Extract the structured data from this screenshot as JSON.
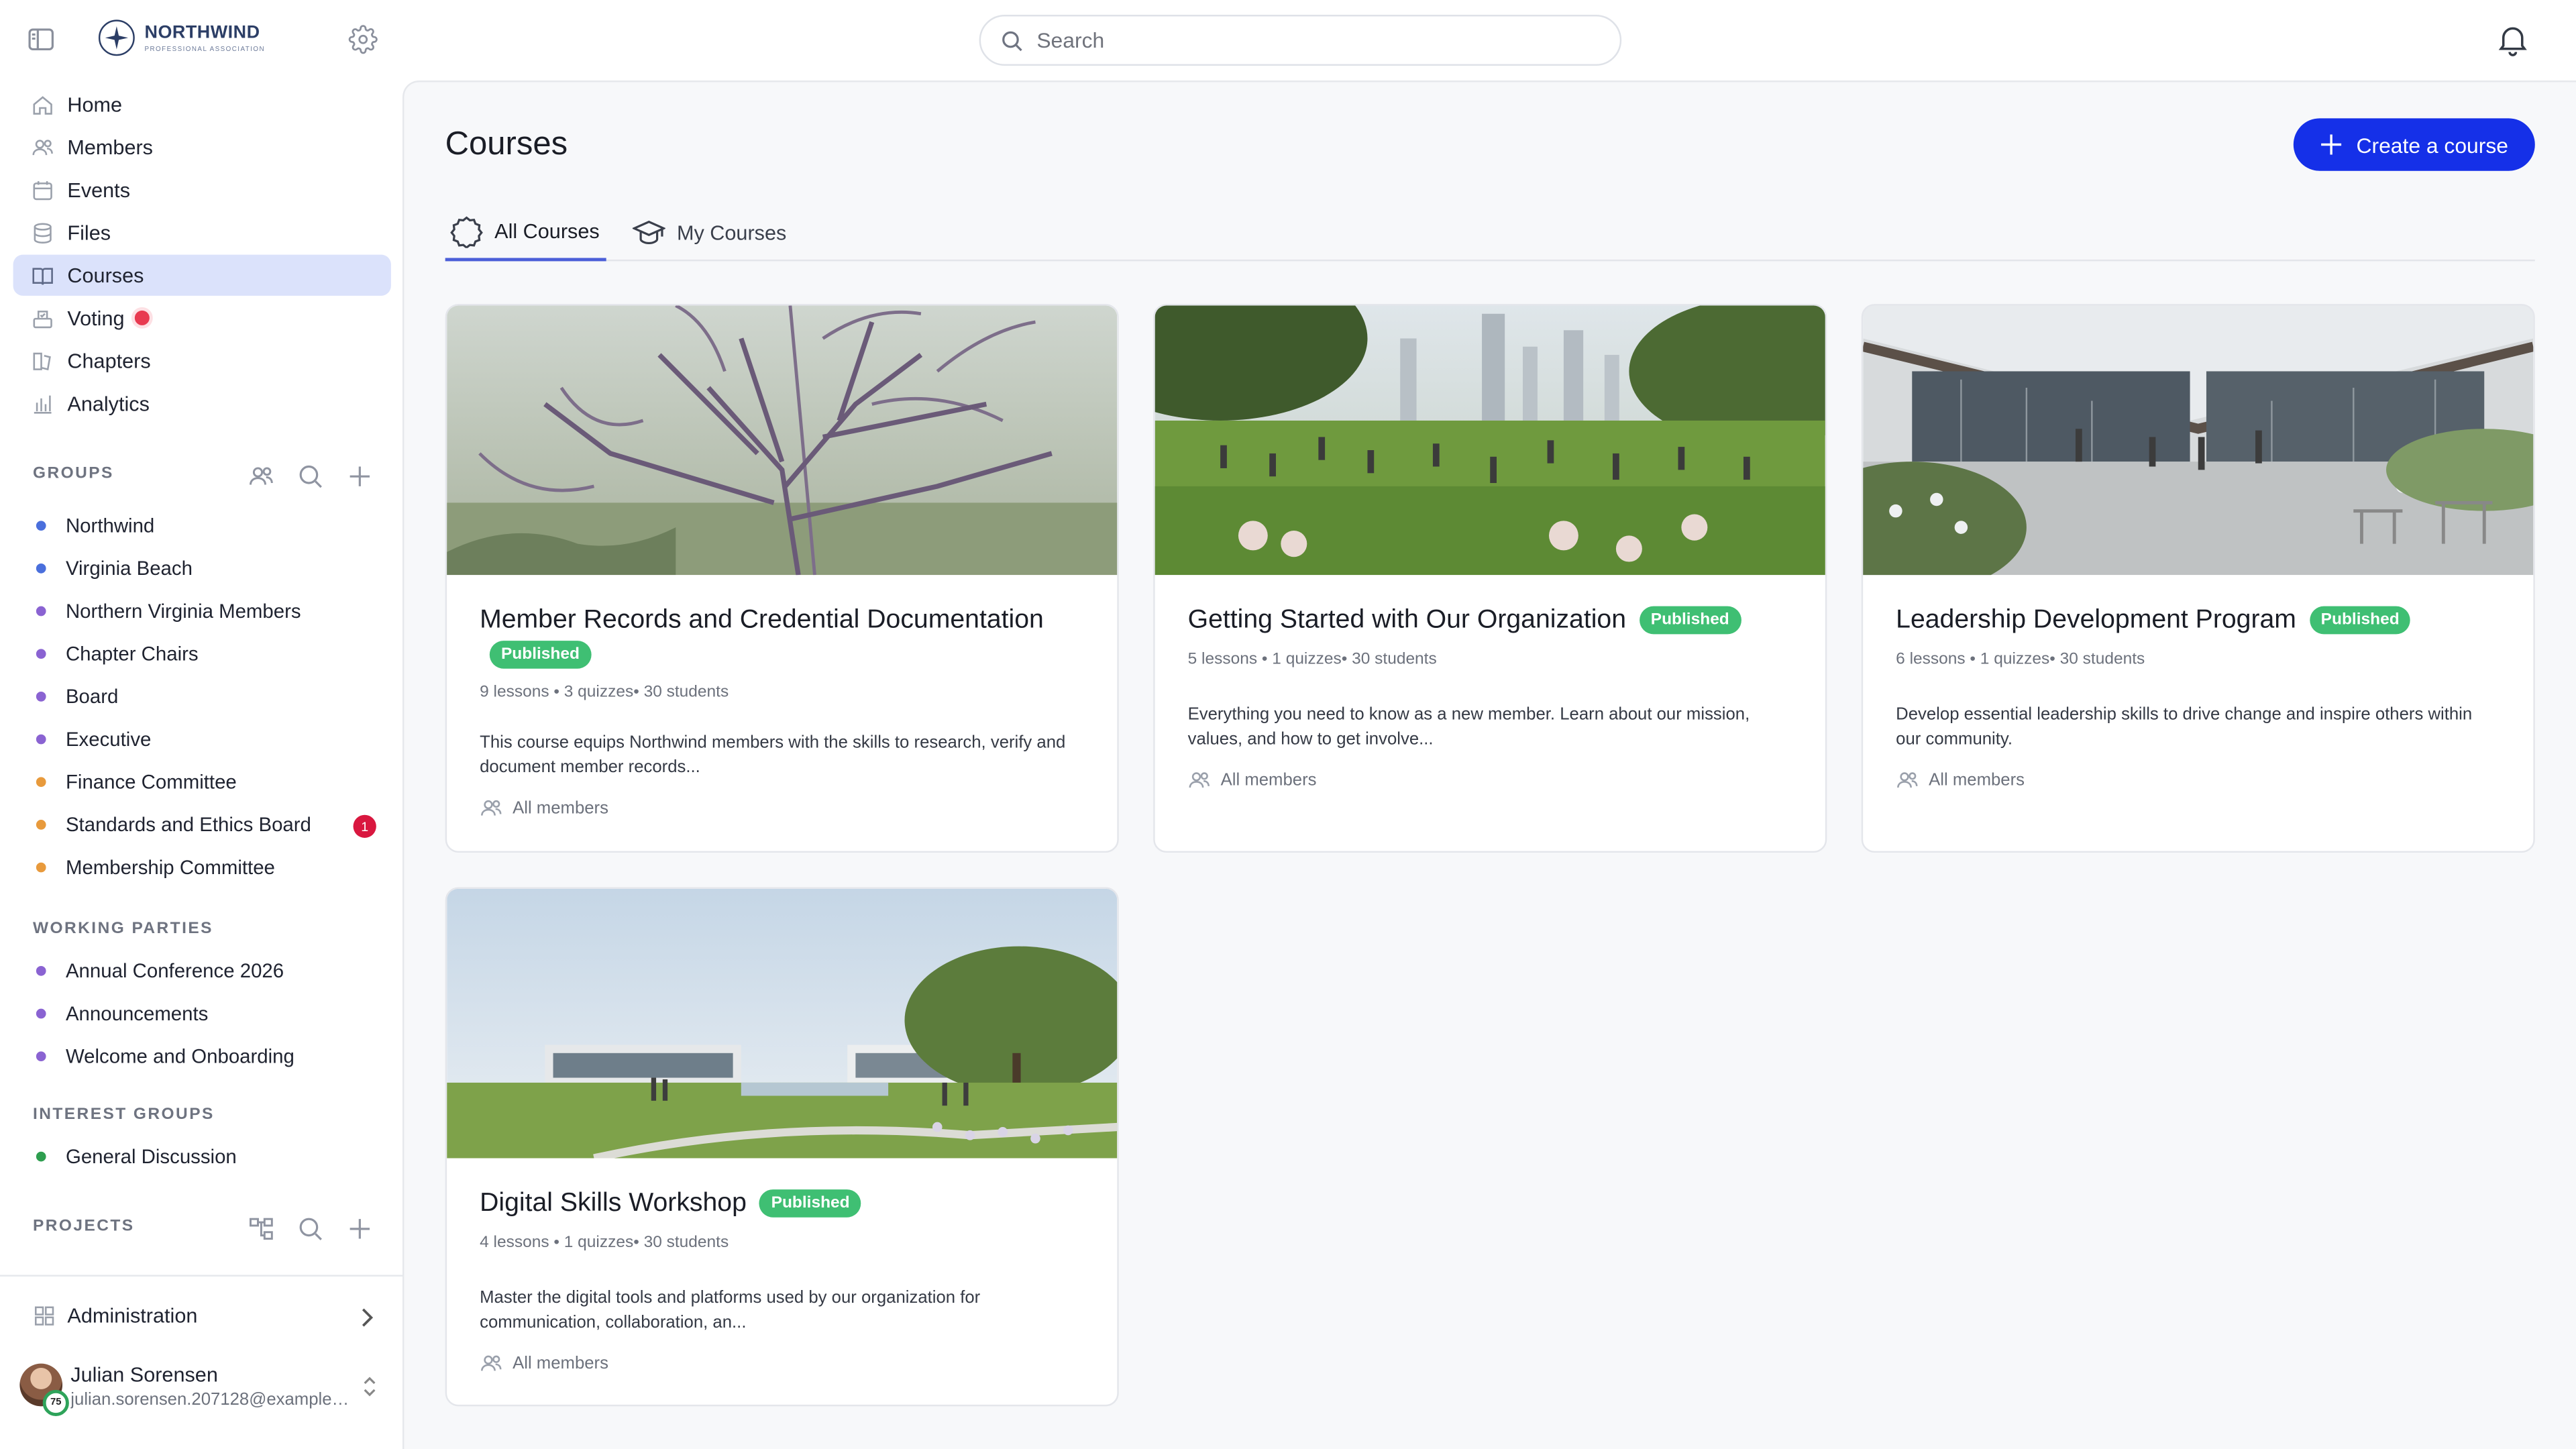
{
  "brand": {
    "name": "NORTHWIND",
    "tagline": "PROFESSIONAL ASSOCIATION"
  },
  "search": {
    "placeholder": "Search"
  },
  "nav": [
    {
      "label": "Home",
      "icon": "home-icon"
    },
    {
      "label": "Members",
      "icon": "members-icon"
    },
    {
      "label": "Events",
      "icon": "calendar-icon"
    },
    {
      "label": "Files",
      "icon": "database-icon"
    },
    {
      "label": "Courses",
      "icon": "book-icon",
      "active": true
    },
    {
      "label": "Voting",
      "icon": "ballot-icon",
      "dot": true
    },
    {
      "label": "Chapters",
      "icon": "chapters-icon"
    },
    {
      "label": "Analytics",
      "icon": "analytics-icon"
    }
  ],
  "groups": {
    "heading": "GROUPS",
    "items": [
      {
        "label": "Northwind",
        "color": "#4a6fdc"
      },
      {
        "label": "Virginia Beach",
        "color": "#4a6fdc"
      },
      {
        "label": "Northern Virginia Members",
        "color": "#8a63d2"
      },
      {
        "label": "Chapter Chairs",
        "color": "#8a63d2"
      },
      {
        "label": "Board",
        "color": "#8a63d2"
      },
      {
        "label": "Executive",
        "color": "#8a63d2"
      },
      {
        "label": "Finance Committee",
        "color": "#e89a3c"
      },
      {
        "label": "Standards and Ethics Board",
        "color": "#e89a3c",
        "badge": "1"
      },
      {
        "label": "Membership Committee",
        "color": "#e89a3c"
      }
    ]
  },
  "working_parties": {
    "heading": "WORKING PARTIES",
    "items": [
      {
        "label": "Annual Conference 2026",
        "color": "#8a63d2"
      },
      {
        "label": "Announcements",
        "color": "#8a63d2"
      },
      {
        "label": "Welcome and Onboarding",
        "color": "#8a63d2"
      }
    ]
  },
  "interest_groups": {
    "heading": "INTEREST GROUPS",
    "items": [
      {
        "label": "General Discussion",
        "color": "#2e9e4f"
      }
    ]
  },
  "projects": {
    "heading": "PROJECTS"
  },
  "admin": {
    "label": "Administration"
  },
  "user": {
    "name": "Julian Sorensen",
    "email": "julian.sorensen.207128@example.com",
    "level": "75"
  },
  "page": {
    "title": "Courses",
    "create_label": "Create a course"
  },
  "tabs": [
    {
      "label": "All Courses",
      "active": true
    },
    {
      "label": "My Courses"
    }
  ],
  "courses": [
    {
      "title": "Member Records and Credential Documentation",
      "status": "Published",
      "meta": "9 lessons • 3 quizzes• 30 students",
      "description": "This course equips Northwind members with the skills to research, verify and document member records...",
      "audience": "All members"
    },
    {
      "title": "Getting Started with Our Organization",
      "status": "Published",
      "meta": "5 lessons • 1 quizzes• 30 students",
      "description": "Everything you need to know as a new member. Learn about our mission, values, and how to get involve...",
      "audience": "All members"
    },
    {
      "title": "Leadership Development Program",
      "status": "Published",
      "meta": "6 lessons • 1 quizzes• 30 students",
      "description": "Develop essential leadership skills to drive change and inspire others within our community.",
      "audience": "All members"
    },
    {
      "title": "Digital Skills Workshop",
      "status": "Published",
      "meta": "4 lessons • 1 quizzes• 30 students",
      "description": "Master the digital tools and platforms used by our organization for communication, collaboration, an...",
      "audience": "All members"
    }
  ],
  "colors": {
    "accent": "#1530e8",
    "published": "#3fbf73",
    "active_nav": "#dbe2fb",
    "alert": "#d9173f"
  }
}
